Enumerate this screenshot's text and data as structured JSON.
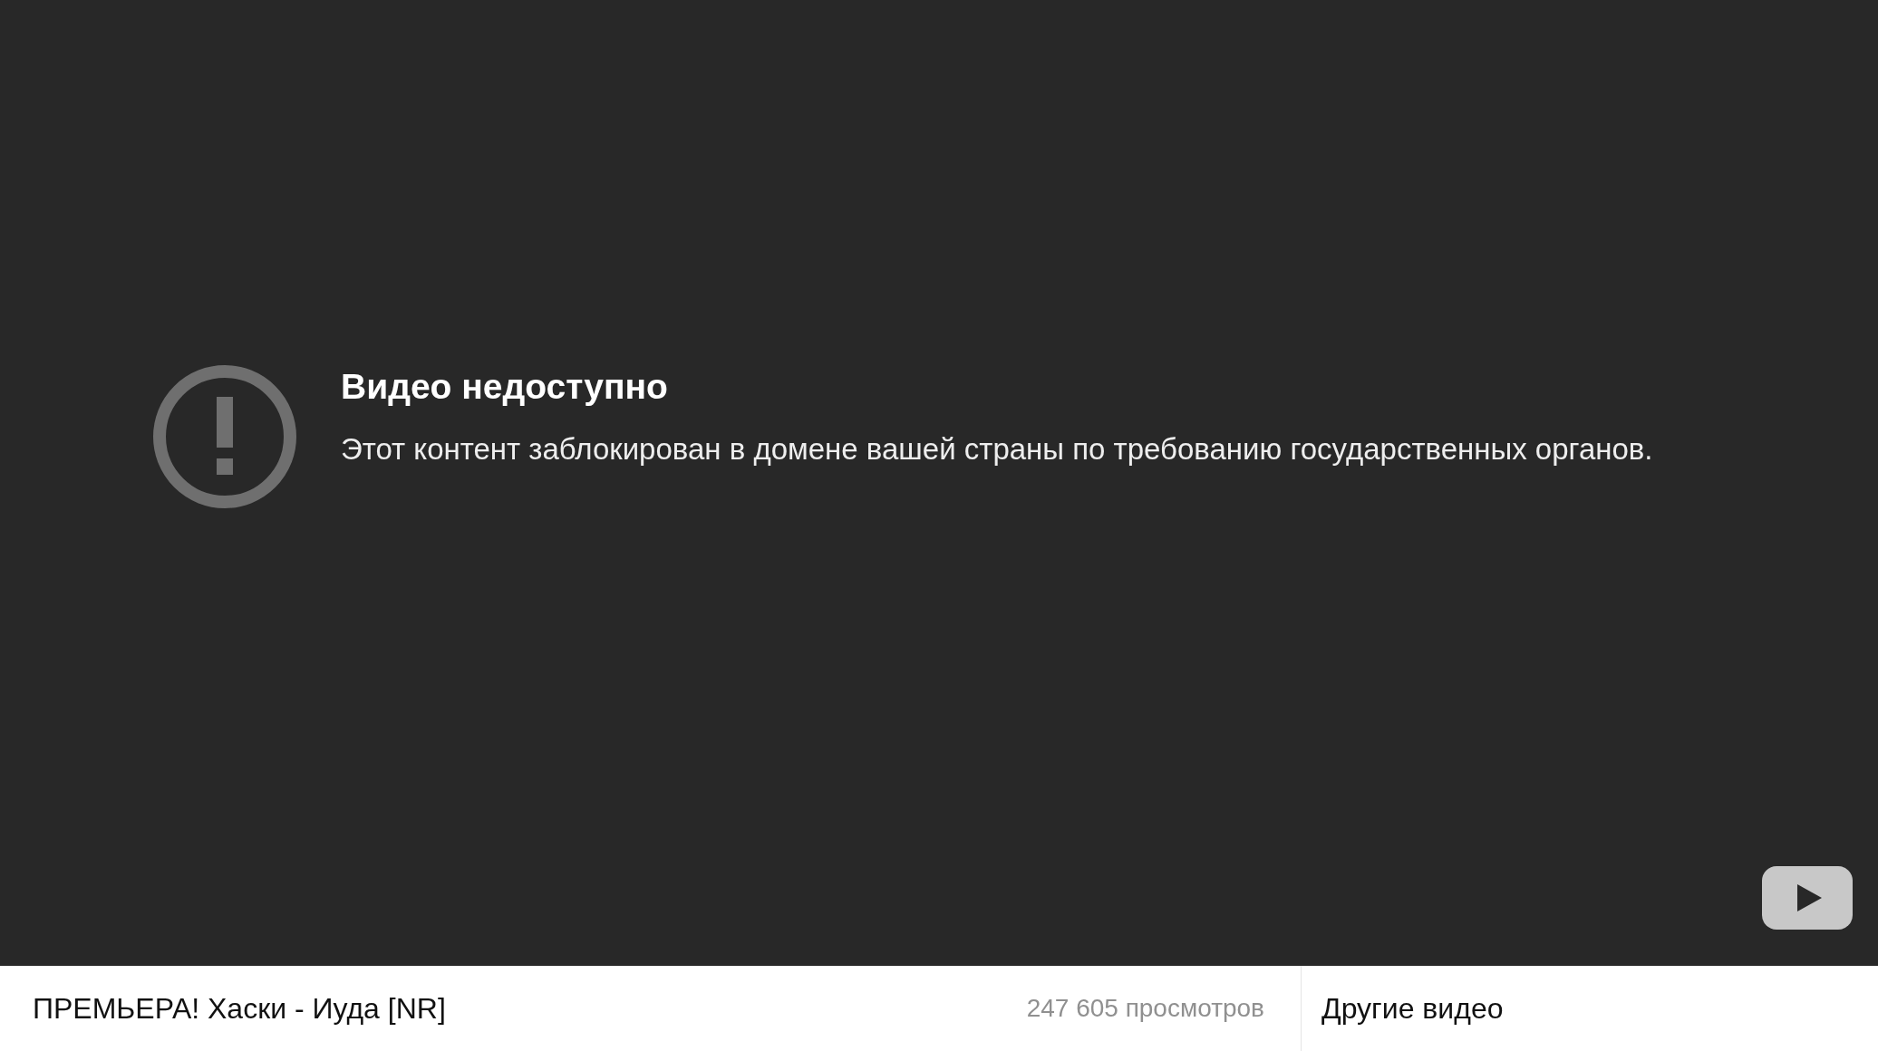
{
  "player": {
    "error": {
      "title": "Видео недоступно",
      "message": "Этот контент заблокирован в домене вашей страны по требованию государственных органов."
    }
  },
  "info_bar": {
    "video_title": "ПРЕМЬЕРА! Хаски - Иуда [NR]",
    "views": "247 605 просмотров",
    "more_videos": "Другие видео"
  }
}
